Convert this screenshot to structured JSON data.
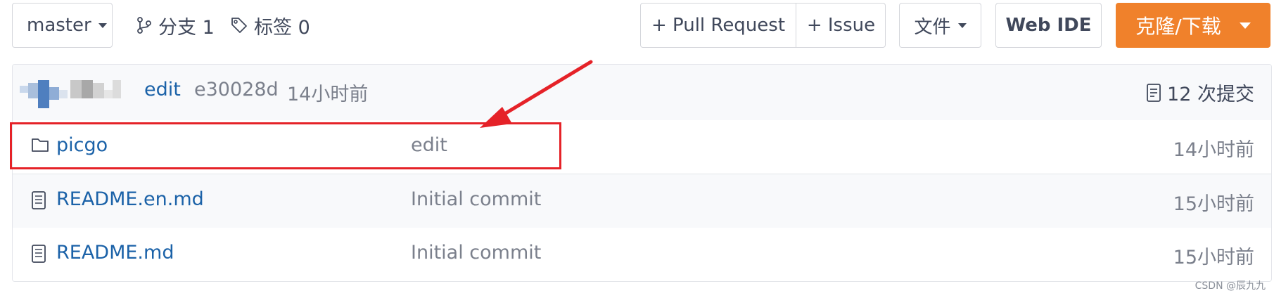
{
  "toolbar": {
    "branch_label": "master",
    "branches_label": "分支 1",
    "tags_label": "标签 0",
    "pull_request_label": "+ Pull Request",
    "issue_label": "+ Issue",
    "files_label": "文件",
    "web_ide_label": "Web IDE",
    "clone_label": "克隆/下载",
    "accent_color": "#f0812b"
  },
  "commit": {
    "message": "edit",
    "hash": "e30028d",
    "time": "14小时前",
    "count_label": "12 次提交"
  },
  "files": [
    {
      "icon": "folder-icon",
      "name": "picgo",
      "message": "edit",
      "time": "14小时前"
    },
    {
      "icon": "file-icon",
      "name": "README.en.md",
      "message": "Initial commit",
      "time": "15小时前"
    },
    {
      "icon": "file-icon",
      "name": "README.md",
      "message": "Initial commit",
      "time": "15小时前"
    }
  ],
  "annotation": {
    "color": "#e52228"
  },
  "watermark": "CSDN @辰九九"
}
